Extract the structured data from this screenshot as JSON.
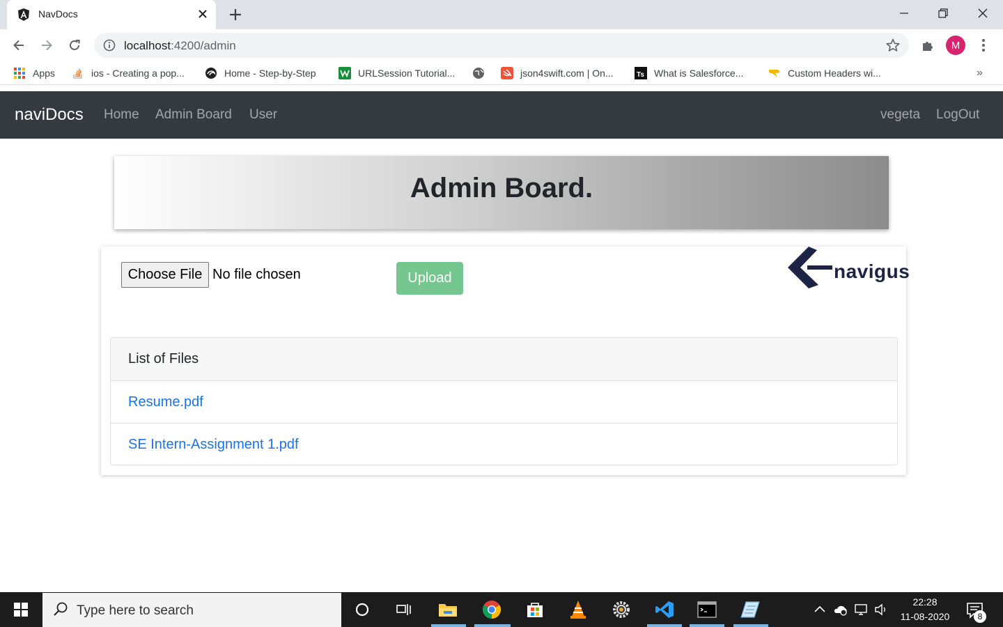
{
  "browser": {
    "tab_title": "NavDocs",
    "url_host": "localhost",
    "url_rest": ":4200/admin",
    "avatar_letter": "M",
    "bookmarks": [
      {
        "label": "Apps",
        "icon": "apps-grid-icon"
      },
      {
        "label": "ios - Creating a pop...",
        "icon": "stackoverflow-icon"
      },
      {
        "label": "Home - Step-by-Step",
        "icon": "swirl-icon"
      },
      {
        "label": "URLSession Tutorial...",
        "icon": "rw-icon"
      },
      {
        "label": "",
        "icon": "globe-icon"
      },
      {
        "label": "json4swift.com | On...",
        "icon": "swift-icon"
      },
      {
        "label": "What is Salesforce...",
        "icon": "ts-icon"
      },
      {
        "label": "Custom Headers wi...",
        "icon": "wing-icon"
      }
    ],
    "more_bookmarks": "»"
  },
  "navbar": {
    "brand": "naviDocs",
    "links": [
      "Home",
      "Admin Board",
      "User"
    ],
    "username": "vegeta",
    "logout": "LogOut"
  },
  "page": {
    "title": "Admin Board.",
    "file_button": "Choose File",
    "file_status": "No file chosen",
    "upload_button": "Upload",
    "logo_text": "navigus",
    "list_header": "List of Files",
    "files": [
      "Resume.pdf",
      "SE Intern-Assignment 1.pdf"
    ]
  },
  "taskbar": {
    "search_placeholder": "Type here to search",
    "time": "22:28",
    "date": "11-08-2020",
    "notification_count": "8"
  },
  "colors": {
    "navbar_bg": "#343a40",
    "upload_bg": "#75c78f",
    "link": "#1a73e8",
    "avatar": "#d6246e"
  }
}
